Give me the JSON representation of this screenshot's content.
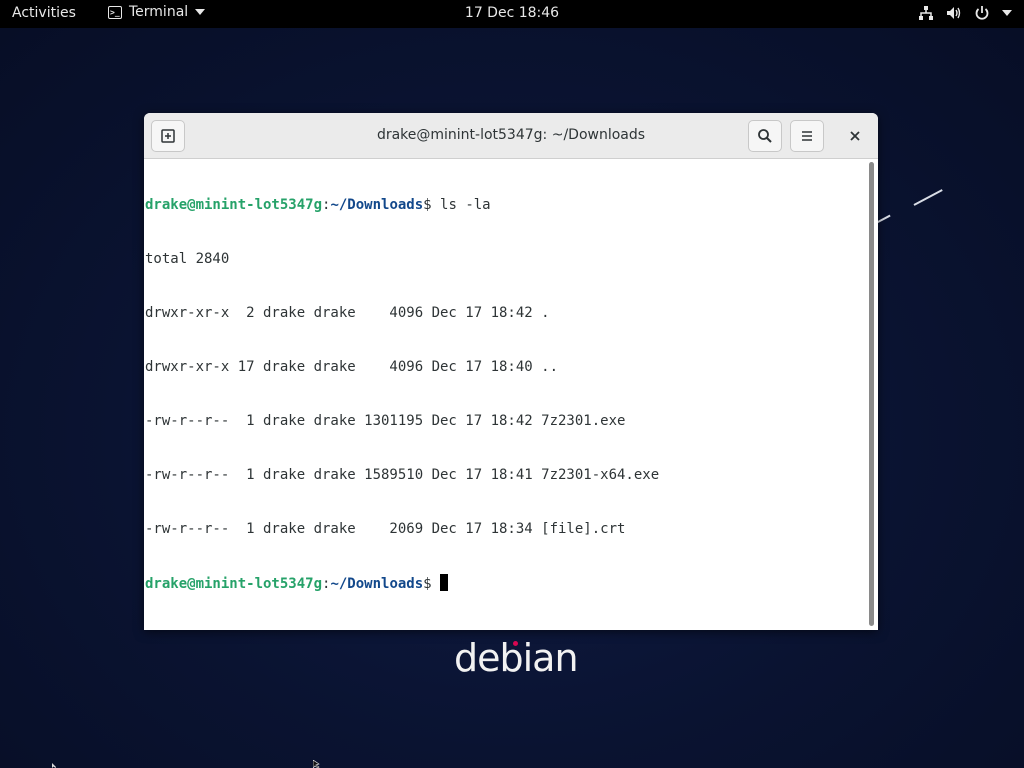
{
  "top_bar": {
    "activities": "Activities",
    "app_name": "Terminal",
    "clock": "17 Dec  18:46"
  },
  "window": {
    "title": "drake@minint-lot5347g: ~/Downloads"
  },
  "terminal": {
    "prompt_user": "drake@minint-lot5347g",
    "prompt_sep": ":",
    "prompt_path": "~/Downloads",
    "prompt_end": "$ ",
    "command": "ls -la",
    "output": [
      "total 2840",
      "drwxr-xr-x  2 drake drake    4096 Dec 17 18:42 .",
      "drwxr-xr-x 17 drake drake    4096 Dec 17 18:40 ..",
      "-rw-r--r--  1 drake drake 1301195 Dec 17 18:42 7z2301.exe",
      "-rw-r--r--  1 drake drake 1589510 Dec 17 18:41 7z2301-x64.exe",
      "-rw-r--r--  1 drake drake    2069 Dec 17 18:34 [file].crt"
    ]
  },
  "desktop": {
    "logo_text": "debian"
  },
  "colors": {
    "prompt_user": "#26a269",
    "prompt_path": "#12488b",
    "desktop_bg": "#0b1433",
    "debian_red": "#d70751"
  },
  "icons": [
    "terminal-icon",
    "network-icon",
    "volume-icon",
    "power-icon",
    "new-tab-icon",
    "search-icon",
    "hamburger-menu-icon",
    "close-icon"
  ]
}
